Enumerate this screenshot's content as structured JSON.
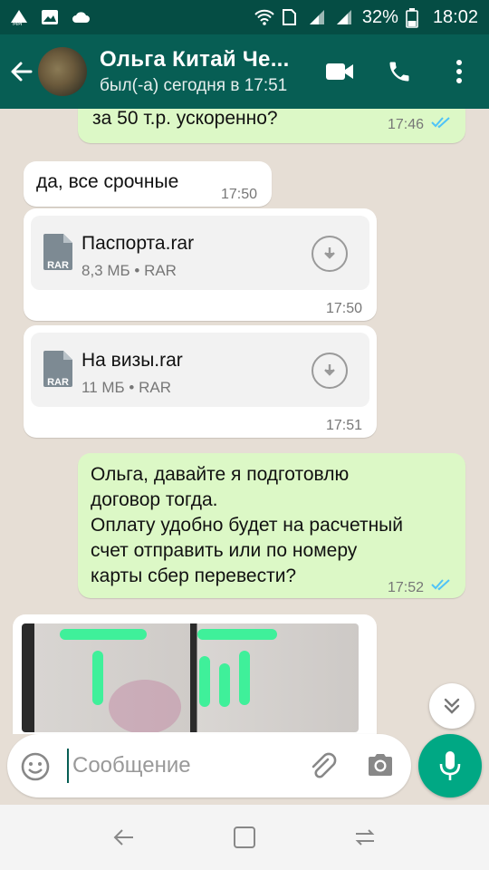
{
  "status_bar": {
    "battery": "32%",
    "time": "18:02"
  },
  "header": {
    "contact_name": "Ольга Китай Че...",
    "last_seen": "был(-а) сегодня в 17:51"
  },
  "messages": [
    {
      "type": "text",
      "direction": "out",
      "text": "за 50 т.р. ускоренно?",
      "time": "17:46",
      "status": "read"
    },
    {
      "type": "text",
      "direction": "in",
      "text": "да, все срочные",
      "time": "17:50"
    },
    {
      "type": "file",
      "direction": "in",
      "file_name": "Паспорта.rar",
      "icon_label": "RAR",
      "size": "8,3 МБ",
      "ext": "RAR",
      "meta": "8,3 МБ • RAR",
      "time": "17:50"
    },
    {
      "type": "file",
      "direction": "in",
      "file_name": "На визы.rar",
      "icon_label": "RAR",
      "size": "11 МБ",
      "ext": "RAR",
      "meta": "11 МБ • RAR",
      "time": "17:51"
    },
    {
      "type": "text",
      "direction": "out",
      "lines": [
        "Ольга, давайте я подготовлю",
        "договор тогда.",
        "Оплату удобно будет на расчетный",
        "счет отправить или по номеру",
        "карты сбер перевести?"
      ],
      "time": "17:52",
      "status": "read"
    },
    {
      "type": "image",
      "direction": "in"
    }
  ],
  "composer": {
    "placeholder": "Сообщение"
  },
  "colors": {
    "status_bar": "#054d44",
    "app_bar": "#075e54",
    "outgoing_bubble": "#dcf8c6",
    "incoming_bubble": "#ffffff",
    "chat_background": "#e6ded5",
    "read_ticks": "#4fc3f7",
    "mic_button": "#00a884"
  },
  "icons": {
    "back": "arrow-left-icon",
    "video_call": "video-camera-icon",
    "voice_call": "phone-icon",
    "menu": "more-vertical-icon",
    "emoji": "smiley-icon",
    "attach": "paperclip-icon",
    "camera": "camera-icon",
    "mic": "microphone-icon",
    "scroll_down": "double-chevron-down-icon",
    "download": "download-icon",
    "file": "rar-file-icon"
  }
}
